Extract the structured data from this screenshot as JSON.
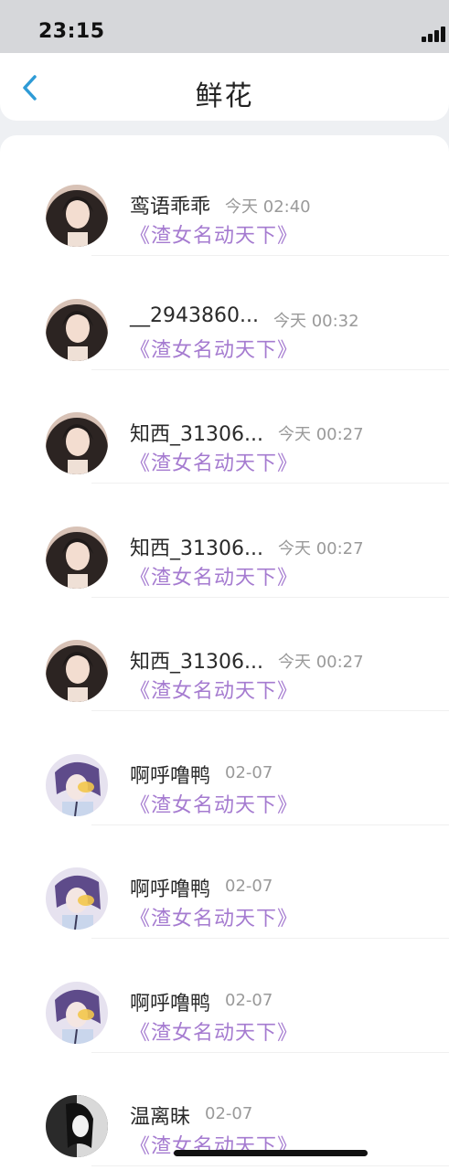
{
  "status_bar": {
    "time": "23:15"
  },
  "header": {
    "title": "鲜花",
    "back_icon": "chevron-left-icon"
  },
  "colors": {
    "accent": "#2e9bd6",
    "book_title": "#a57bd0",
    "timestamp": "#9a9a9a"
  },
  "gifts": [
    {
      "name": "鸾语乖乖",
      "time": "今天 02:40",
      "book": "《渣女名动天下》",
      "avatar": "avatar-photo"
    },
    {
      "name": "__2943860...",
      "time": "今天 00:32",
      "book": "《渣女名动天下》",
      "avatar": "avatar-photo"
    },
    {
      "name": "知西_31306...",
      "time": "今天 00:27",
      "book": "《渣女名动天下》",
      "avatar": "avatar-photo"
    },
    {
      "name": "知西_31306...",
      "time": "今天 00:27",
      "book": "《渣女名动天下》",
      "avatar": "avatar-photo"
    },
    {
      "name": "知西_31306...",
      "time": "今天 00:27",
      "book": "《渣女名动天下》",
      "avatar": "avatar-photo"
    },
    {
      "name": "啊呼噜鸭",
      "time": "02-07",
      "book": "《渣女名动天下》",
      "avatar": "avatar-illustration"
    },
    {
      "name": "啊呼噜鸭",
      "time": "02-07",
      "book": "《渣女名动天下》",
      "avatar": "avatar-illustration"
    },
    {
      "name": "啊呼噜鸭",
      "time": "02-07",
      "book": "《渣女名动天下》",
      "avatar": "avatar-illustration"
    },
    {
      "name": "温离昧",
      "time": "02-07",
      "book": "《渣女名动天下》",
      "avatar": "avatar-sketch"
    }
  ]
}
